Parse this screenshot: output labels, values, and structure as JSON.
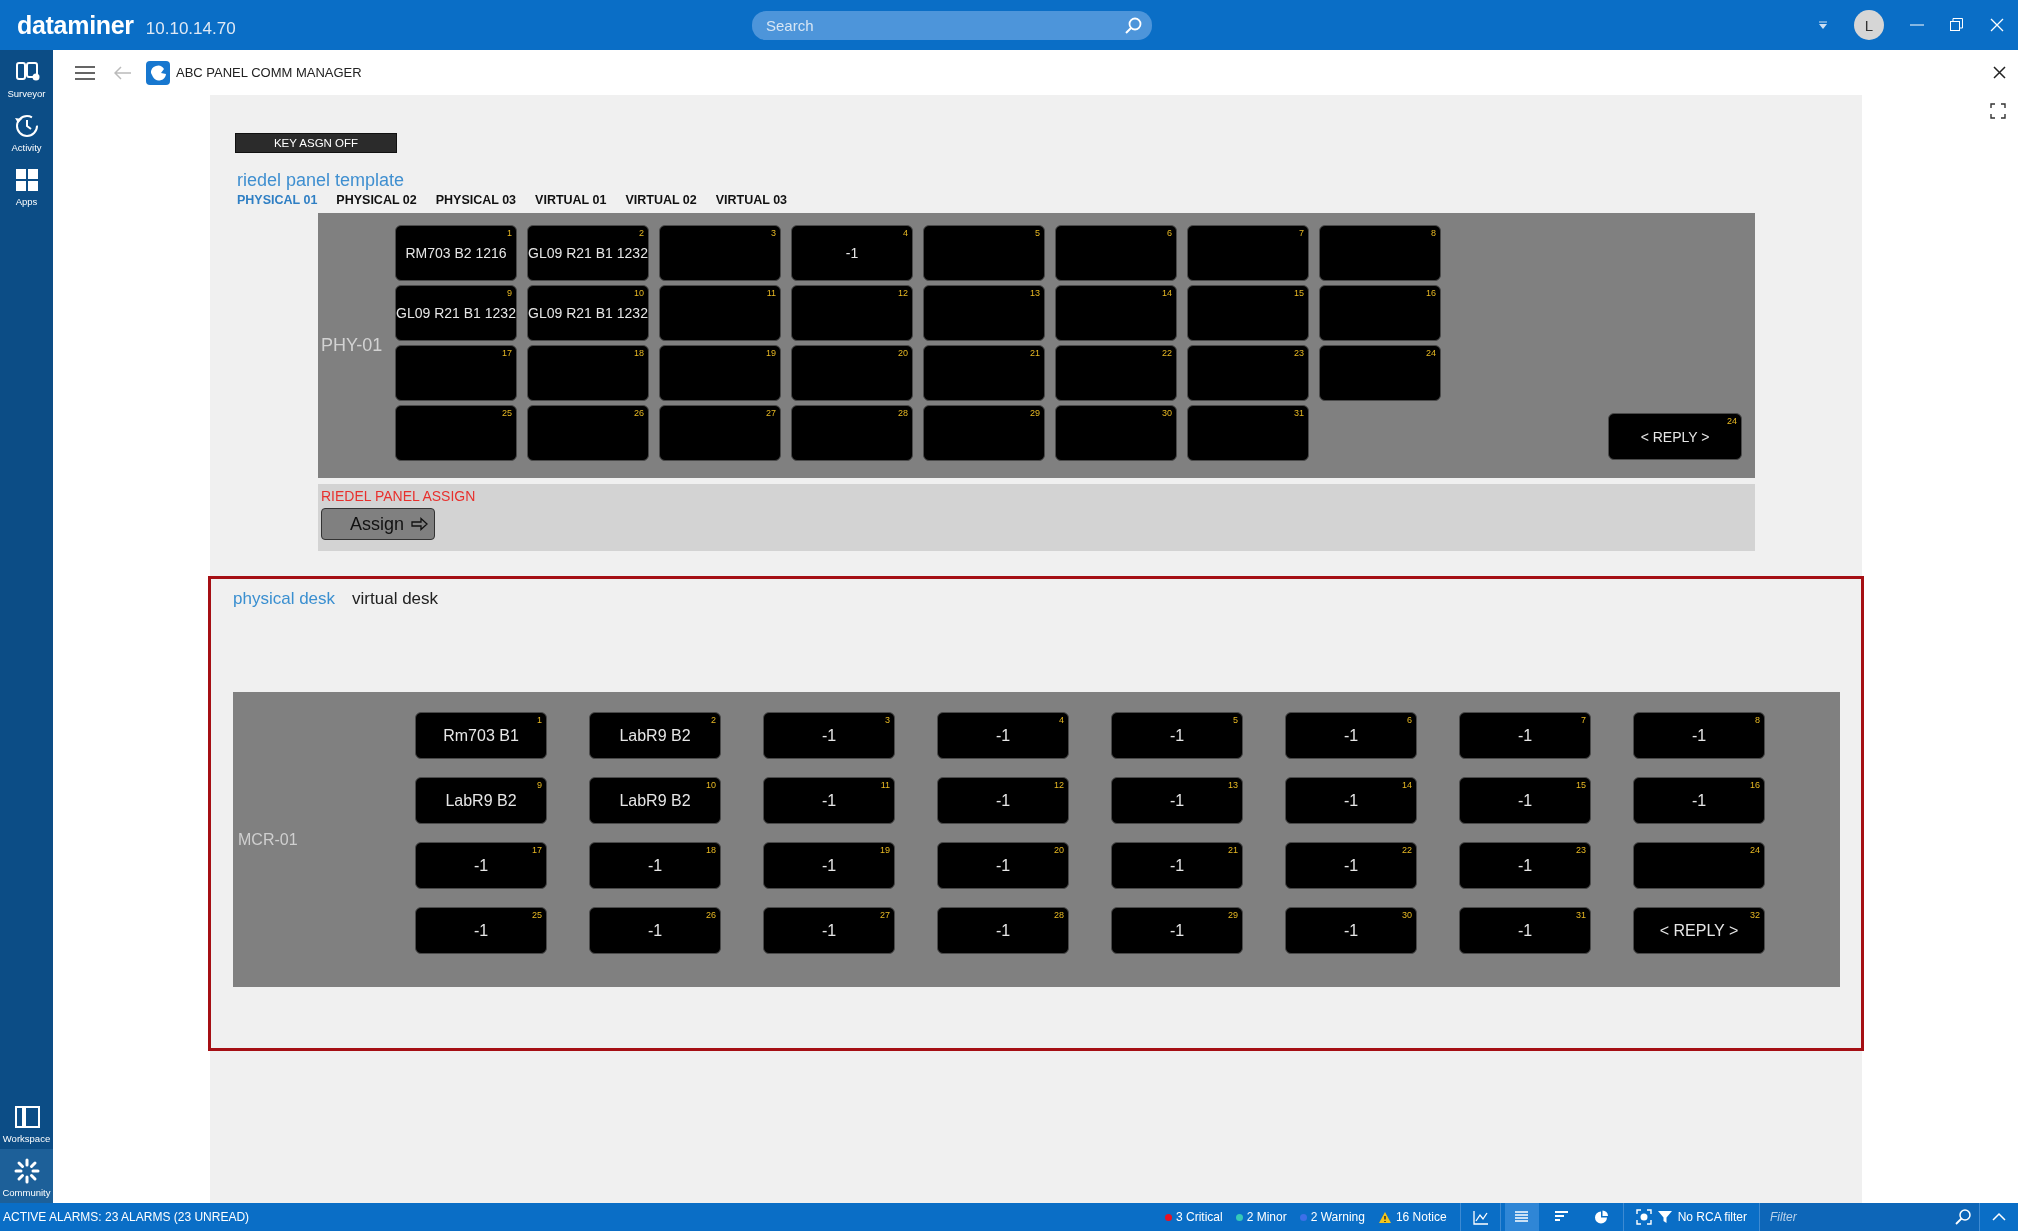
{
  "topbar": {
    "brand": "dataminer",
    "version": "10.10.14.70",
    "search": {
      "placeholder": "Search"
    },
    "avatar": "L"
  },
  "sidebar": {
    "items": [
      {
        "kind": "surveyor",
        "label": "Surveyor"
      },
      {
        "kind": "activity",
        "label": "Activity"
      },
      {
        "kind": "apps",
        "label": "Apps"
      }
    ],
    "bottom_items": [
      {
        "kind": "workspace",
        "label": "Workspace"
      },
      {
        "kind": "community",
        "label": "Community"
      }
    ]
  },
  "header": {
    "title": "ABC PANEL COMM MANAGER"
  },
  "key_assign_button": "KEY ASGN OFF",
  "template": {
    "title": "riedel panel template",
    "tabs": [
      {
        "label": "PHYSICAL 01",
        "selected": true
      },
      {
        "label": "PHYSICAL 02",
        "selected": false
      },
      {
        "label": "PHYSICAL 03",
        "selected": false
      },
      {
        "label": "VIRTUAL 01",
        "selected": false
      },
      {
        "label": "VIRTUAL 02",
        "selected": false
      },
      {
        "label": "VIRTUAL 03",
        "selected": false
      }
    ],
    "panel": {
      "label": "PHY-01",
      "keys": [
        {
          "number": "1",
          "text": "RM703 B2 1216"
        },
        {
          "number": "2",
          "text": "GL09 R21 B1 1232"
        },
        {
          "number": "3"
        },
        {
          "number": "4",
          "text": "-1"
        },
        {
          "number": "5"
        },
        {
          "number": "6"
        },
        {
          "number": "7"
        },
        {
          "number": "8"
        },
        {
          "number": "9",
          "text": "GL09 R21 B1 1232"
        },
        {
          "number": "10",
          "text": "GL09 R21 B1 1232"
        },
        {
          "number": "11"
        },
        {
          "number": "12"
        },
        {
          "number": "13"
        },
        {
          "number": "14"
        },
        {
          "number": "15"
        },
        {
          "number": "16"
        },
        {
          "number": "17"
        },
        {
          "number": "18"
        },
        {
          "number": "19"
        },
        {
          "number": "20"
        },
        {
          "number": "21"
        },
        {
          "number": "22"
        },
        {
          "number": "23"
        },
        {
          "number": "24"
        },
        {
          "number": "25"
        },
        {
          "number": "26"
        },
        {
          "number": "27"
        },
        {
          "number": "28"
        },
        {
          "number": "29"
        },
        {
          "number": "30"
        },
        {
          "number": "31"
        }
      ],
      "reply": {
        "number": "24",
        "text": "< REPLY >"
      }
    }
  },
  "assign": {
    "title": "RIEDEL PANEL ASSIGN",
    "button": "Assign"
  },
  "desk": {
    "tabs": [
      {
        "label": "physical desk",
        "selected": true
      },
      {
        "label": "virtual desk",
        "selected": false
      }
    ],
    "panel": {
      "label": "MCR-01",
      "keys": [
        {
          "number": "1",
          "text": "Rm703 B1"
        },
        {
          "number": "2",
          "text": "LabR9 B2"
        },
        {
          "number": "3",
          "text": "-1"
        },
        {
          "number": "4",
          "text": "-1"
        },
        {
          "number": "5",
          "text": "-1"
        },
        {
          "number": "6",
          "text": "-1"
        },
        {
          "number": "7",
          "text": "-1"
        },
        {
          "number": "8",
          "text": "-1"
        },
        {
          "number": "9",
          "text": "LabR9 B2"
        },
        {
          "number": "10",
          "text": "LabR9 B2"
        },
        {
          "number": "11",
          "text": "-1"
        },
        {
          "number": "12",
          "text": "-1"
        },
        {
          "number": "13",
          "text": "-1"
        },
        {
          "number": "14",
          "text": "-1"
        },
        {
          "number": "15",
          "text": "-1"
        },
        {
          "number": "16",
          "text": "-1"
        },
        {
          "number": "17",
          "text": "-1"
        },
        {
          "number": "18",
          "text": "-1"
        },
        {
          "number": "19",
          "text": "-1"
        },
        {
          "number": "20",
          "text": "-1"
        },
        {
          "number": "21",
          "text": "-1"
        },
        {
          "number": "22",
          "text": "-1"
        },
        {
          "number": "23",
          "text": "-1"
        },
        {
          "number": "24"
        },
        {
          "number": "25",
          "text": "-1"
        },
        {
          "number": "26",
          "text": "-1"
        },
        {
          "number": "27",
          "text": "-1"
        },
        {
          "number": "28",
          "text": "-1"
        },
        {
          "number": "29",
          "text": "-1"
        },
        {
          "number": "30",
          "text": "-1"
        },
        {
          "number": "31",
          "text": "-1"
        },
        {
          "number": "32",
          "text": "< REPLY >"
        }
      ]
    }
  },
  "status_bar": {
    "text": "ACTIVE ALARMS: 23 ALARMS (23 UNREAD)",
    "alarms": [
      {
        "text": "3 Critical",
        "color": "#e81123"
      },
      {
        "text": "2 Minor",
        "color": "#35c9b8"
      },
      {
        "text": "2 Warning",
        "color": "#3d6fe8"
      }
    ],
    "notice": "16 Notice",
    "views": [
      {
        "kind": "list",
        "selected": true
      },
      {
        "kind": "sort",
        "selected": false
      },
      {
        "kind": "pie",
        "selected": false
      }
    ],
    "rca": "No RCA filter",
    "filter": {
      "placeholder": "Filter"
    }
  }
}
